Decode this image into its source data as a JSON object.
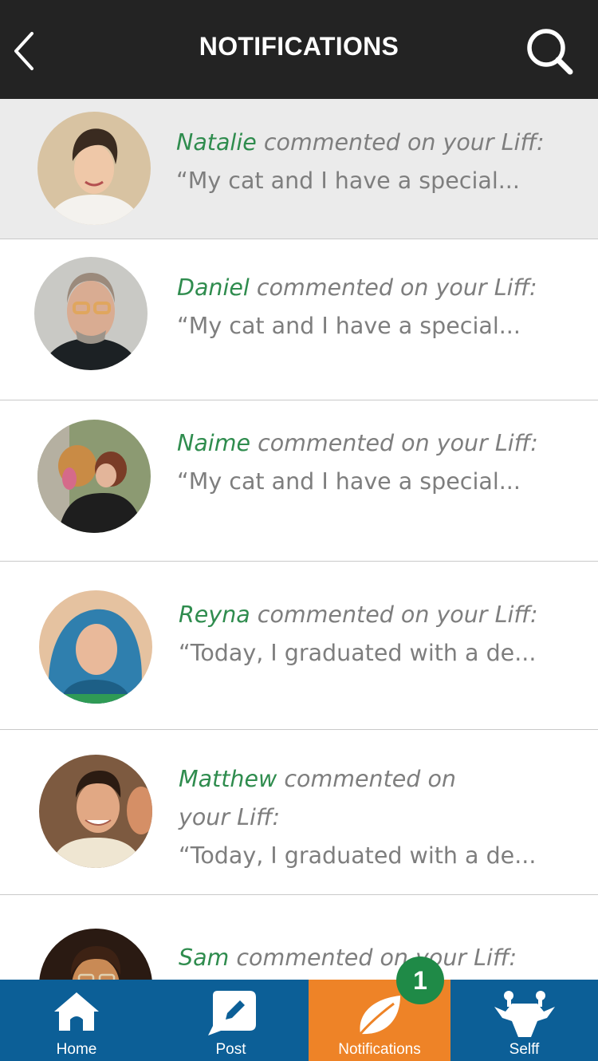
{
  "header": {
    "title": "NOTIFICATIONS",
    "back_icon": "chevron-left-icon",
    "search_icon": "search-icon"
  },
  "notifications": [
    {
      "name": "Natalie",
      "action": "commented on your Liff:",
      "preview": "“My cat and I have a special...",
      "highlighted": true
    },
    {
      "name": "Daniel",
      "action": "commented on your Liff:",
      "preview": "“My cat and I have a special...",
      "highlighted": false
    },
    {
      "name": "Naime",
      "action": "commented on your Liff:",
      "preview": "“My cat and I have a special...",
      "highlighted": false
    },
    {
      "name": "Reyna",
      "action": "commented on your Liff:",
      "preview": "“Today, I graduated with a de...",
      "highlighted": false
    },
    {
      "name": "Matthew",
      "action": "commented on your Liff:",
      "preview": "“Today, I graduated with a de...",
      "highlighted": false
    },
    {
      "name": "Sam",
      "action": "commented on your Liff:",
      "preview": "",
      "highlighted": false
    }
  ],
  "tabbar": {
    "tabs": [
      {
        "label": "Home",
        "icon": "home-icon"
      },
      {
        "label": "Post",
        "icon": "pencil-icon"
      },
      {
        "label": "Notifications",
        "icon": "leaf-icon",
        "active": true
      },
      {
        "label": "Selff",
        "icon": "giraffe-icon"
      }
    ],
    "badge": "1"
  },
  "colors": {
    "header_bg": "#232323",
    "name_green": "#2f8c4e",
    "tabbar_blue": "#0c5f97",
    "tab_active_orange": "#ee8327",
    "badge_green": "#1f8a47"
  }
}
